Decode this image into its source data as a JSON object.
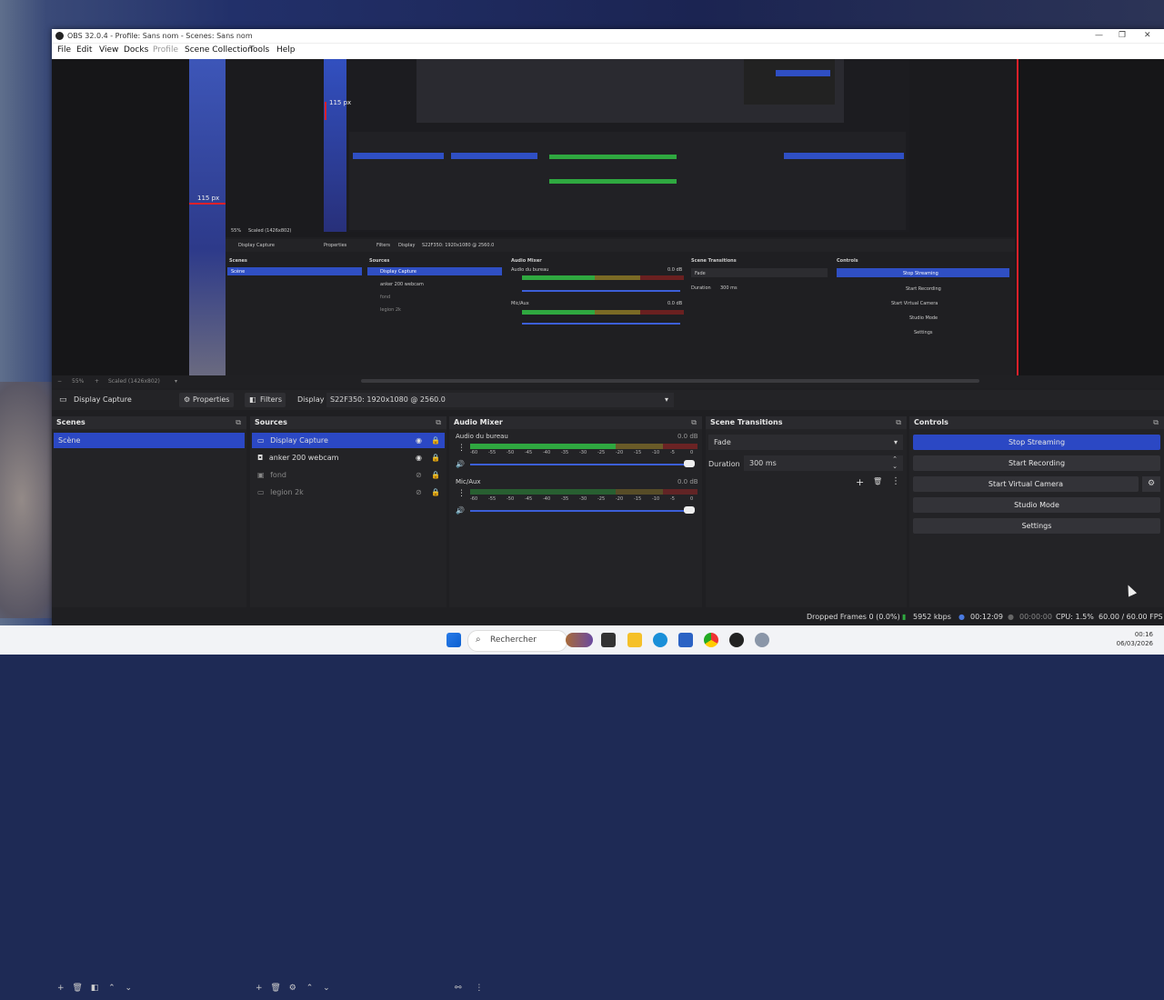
{
  "window": {
    "title": "OBS 32.0.4 - Profile: Sans nom - Scenes: Sans nom",
    "controls": [
      "—",
      "❐",
      "✕"
    ]
  },
  "menu": [
    {
      "label": "File",
      "enabled": true
    },
    {
      "label": "Edit",
      "enabled": true
    },
    {
      "label": "View",
      "enabled": true
    },
    {
      "label": "Docks",
      "enabled": true
    },
    {
      "label": "Profile",
      "enabled": false
    },
    {
      "label": "Scene Collection",
      "enabled": true
    },
    {
      "label": "Tools",
      "enabled": true
    },
    {
      "label": "Help",
      "enabled": true
    }
  ],
  "preview": {
    "ruler_label_top": "115 px",
    "ruler_label_left": "115 px",
    "inner": {
      "zoom": "55%",
      "scaled": "Scaled (1426x802)",
      "source_name": "Display Capture",
      "properties": "Properties",
      "filters": "Filters",
      "display_label": "Display",
      "display_value": "S22F350: 1920x1080 @ 2560.0",
      "docks": [
        "Scenes",
        "Sources",
        "Audio Mixer",
        "Scene Transitions",
        "Controls"
      ],
      "scene": "Scène",
      "sources": [
        "Display Capture",
        "anker 200 webcam",
        "fond",
        "legion 2k"
      ],
      "mixer_channels": [
        "Audio du bureau",
        "Mic/Aux"
      ],
      "mixer_db": [
        "0.0 dB",
        "0.0 dB"
      ],
      "transition": "Fade",
      "duration_label": "Duration",
      "duration_value": "300 ms",
      "controls": [
        "Stop Streaming",
        "Start Recording",
        "Start Virtual Camera",
        "Studio Mode",
        "Settings"
      ]
    }
  },
  "zoombar": {
    "zoom": "55%",
    "scaled": "Scaled (1426x802)"
  },
  "propbar": {
    "source_name": "Display Capture",
    "properties": "Properties",
    "filters": "Filters",
    "display_label": "Display",
    "display_value": "S22F350: 1920x1080 @ 2560.0"
  },
  "docks": {
    "scenes": {
      "title": "Scenes",
      "items": [
        "Scène"
      ]
    },
    "sources": {
      "title": "Sources",
      "items": [
        {
          "name": "Display Capture",
          "icon": "monitor-icon",
          "visible": true,
          "selected": true
        },
        {
          "name": "anker 200 webcam",
          "icon": "camera-icon",
          "visible": true,
          "selected": false
        },
        {
          "name": "fond",
          "icon": "image-icon",
          "visible": false,
          "selected": false
        },
        {
          "name": "legion  2k",
          "icon": "monitor-icon",
          "visible": false,
          "selected": false
        }
      ]
    },
    "mixer": {
      "title": "Audio Mixer",
      "channels": [
        {
          "name": "Audio du bureau",
          "db": "0.0 dB",
          "level": 0.53
        },
        {
          "name": "Mic/Aux",
          "db": "0.0 dB",
          "level": 0.0
        }
      ],
      "scale": [
        "-60",
        "-55",
        "-50",
        "-45",
        "-40",
        "-35",
        "-30",
        "-25",
        "-20",
        "-15",
        "-10",
        "-5",
        "0"
      ]
    },
    "transitions": {
      "title": "Scene Transitions",
      "transition": "Fade",
      "duration_label": "Duration",
      "duration_value": "300 ms"
    },
    "controls": {
      "title": "Controls",
      "buttons": [
        "Stop Streaming",
        "Start Recording",
        "Start Virtual Camera",
        "Studio Mode",
        "Settings"
      ]
    }
  },
  "status": {
    "dropped": "Dropped Frames 0 (0.0%)",
    "bitrate": "5952 kbps",
    "stream_time": "00:12:09",
    "rec_time": "00:00:00",
    "cpu": "CPU: 1.5%",
    "fps": "60.00 / 60.00 FPS"
  },
  "taskbar": {
    "search": "Rechercher",
    "time": "00:16",
    "date": "06/03/2026"
  },
  "colors": {
    "accent": "#2b48c4",
    "red": "#e0202a",
    "meter_green": "#2fa840",
    "meter_yellow": "#a58a2a",
    "meter_red": "#8a2424"
  }
}
